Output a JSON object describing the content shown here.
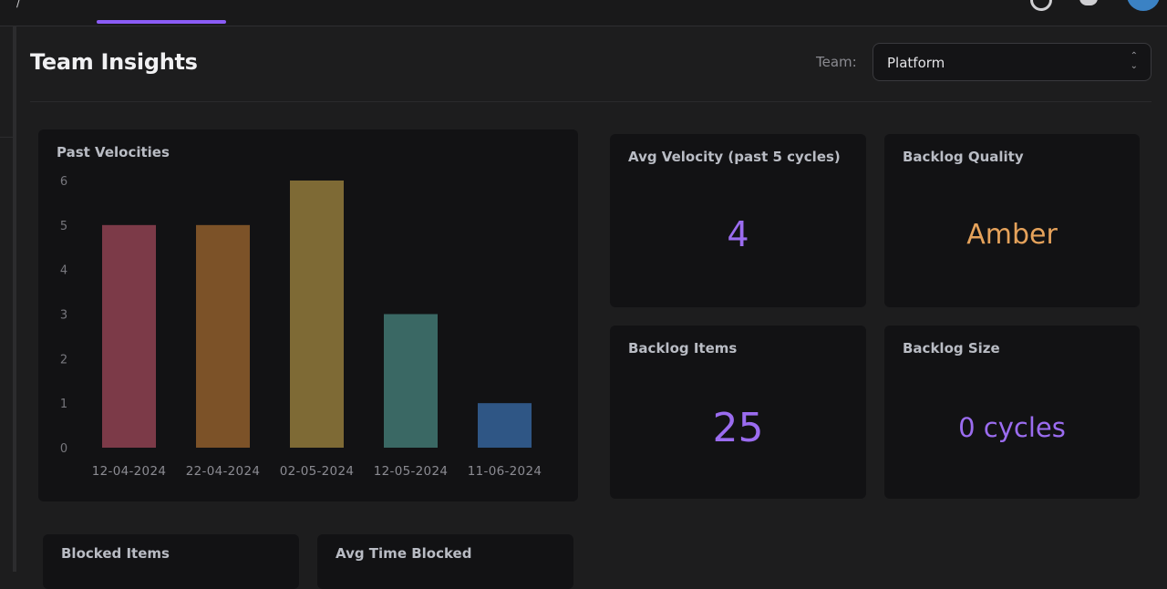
{
  "header": {
    "active_tab_indicator_color": "#8b5cf6",
    "icons": [
      "help-icon",
      "bell-icon",
      "avatar"
    ]
  },
  "page": {
    "title": "Team Insights"
  },
  "team_filter": {
    "label": "Team:",
    "value": "Platform"
  },
  "cards": {
    "past_velocities": {
      "title": "Past Velocities"
    },
    "avg_velocity": {
      "title": "Avg Velocity (past 5 cycles)",
      "value": "4",
      "value_color": "#9b6cf0"
    },
    "backlog_quality": {
      "title": "Backlog Quality",
      "value": "Amber",
      "value_color": "#e5a25b"
    },
    "backlog_items": {
      "title": "Backlog Items",
      "value": "25",
      "value_color": "#9b6cf0"
    },
    "backlog_size": {
      "title": "Backlog Size",
      "value": "0 cycles",
      "value_color": "#9b6cf0"
    },
    "blocked_items": {
      "title": "Blocked Items"
    },
    "avg_time_blocked": {
      "title": "Avg Time Blocked"
    }
  },
  "chart_data": {
    "type": "bar",
    "title": "Past Velocities",
    "categories": [
      "12-04-2024",
      "22-04-2024",
      "02-05-2024",
      "12-05-2024",
      "11-06-2024"
    ],
    "values": [
      5,
      5,
      6,
      3,
      1
    ],
    "colors": [
      "#7c3a48",
      "#7c5228",
      "#7e6a35",
      "#3a6864",
      "#2f5685"
    ],
    "ylim": [
      0,
      6
    ],
    "yticks": [
      0,
      1,
      2,
      3,
      4,
      5,
      6
    ],
    "grid": false,
    "xlabel": "",
    "ylabel": ""
  }
}
